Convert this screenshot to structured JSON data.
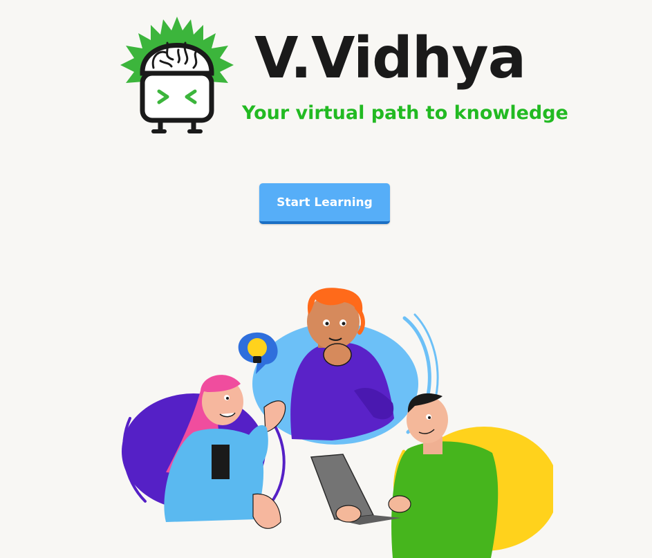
{
  "brand": {
    "name": "V.Vidhya",
    "tagline": "Your virtual path to knowledge",
    "logo_icon": "brain-robot-icon"
  },
  "actions": {
    "start_label": "Start Learning"
  },
  "hero": {
    "icon": "students-collaborating-illustration",
    "idea_icon": "lightbulb-icon"
  },
  "colors": {
    "background": "#f8f7f4",
    "title": "#1a1a1a",
    "tagline": "#22ba22",
    "button": "#56aef8",
    "button_shadow": "#1a6fc4",
    "logo_burst": "#3cb53c"
  }
}
